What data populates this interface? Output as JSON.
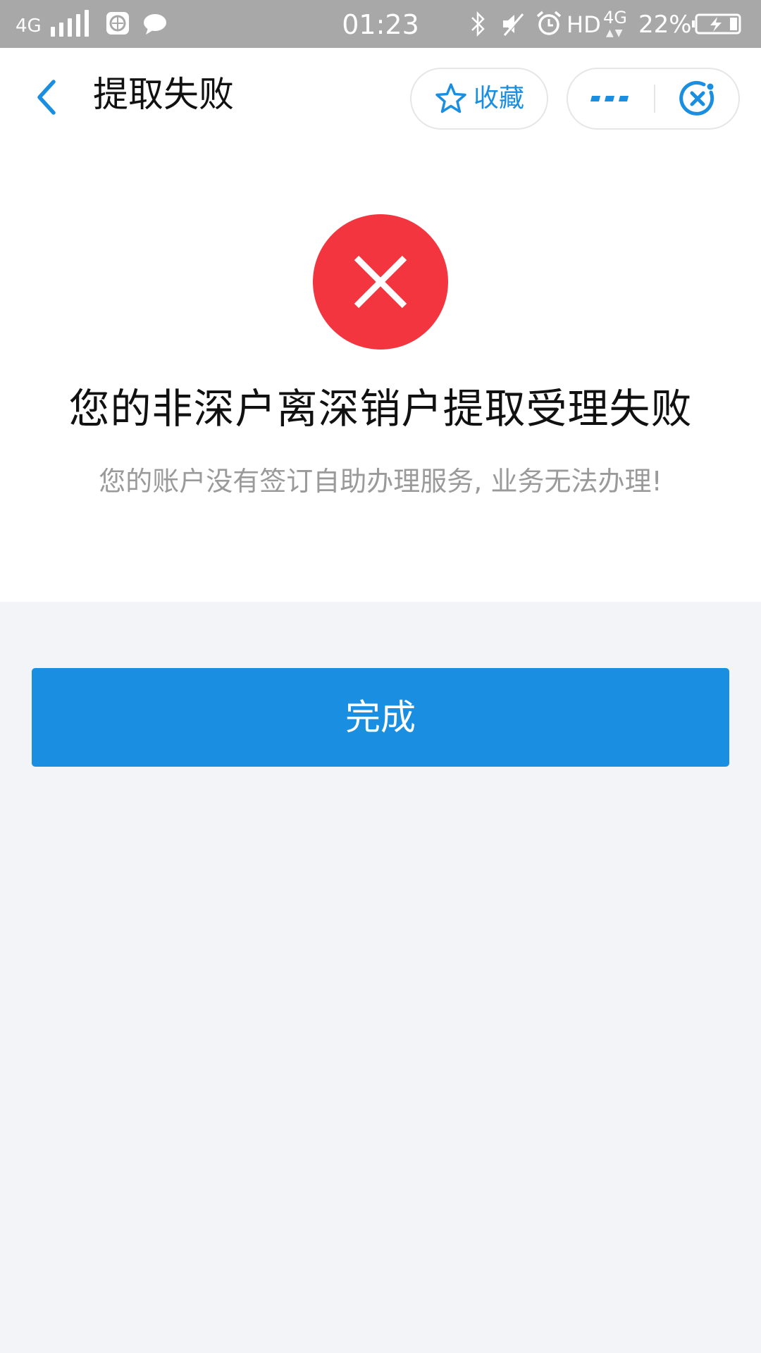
{
  "status_bar": {
    "network": "4G",
    "time": "01:23",
    "hd": "HD",
    "network_secondary": "4G",
    "battery": "22%",
    "icons": [
      "signal-icon",
      "app-icon",
      "message-icon",
      "bluetooth-icon",
      "mute-icon",
      "alarm-icon",
      "battery-icon"
    ]
  },
  "header": {
    "title": "提取失败",
    "favorite_label": "收藏",
    "icons": [
      "back-icon",
      "star-icon",
      "more-icon",
      "close-miniapp-icon"
    ]
  },
  "result": {
    "status": "error",
    "title": "您的非深户离深销户提取受理失败",
    "description": "您的账户没有签订自助办理服务, 业务无法办理!"
  },
  "actions": {
    "done_label": "完成"
  },
  "colors": {
    "accent": "#1a8ee0",
    "error": "#f2353f",
    "status_bar": "#a8a8a8",
    "page_background": "#f2f4f8"
  }
}
